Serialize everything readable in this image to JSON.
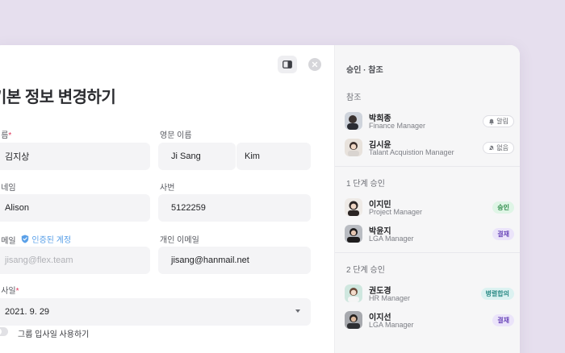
{
  "form": {
    "title": "기본 정보 변경하기",
    "name_label": "이름",
    "name_required": "*",
    "name_value": "김지상",
    "eng_name_label": "영문 이름",
    "eng_first": "Ji Sang",
    "eng_last": "Kim",
    "nickname_label": "닉네임",
    "nickname_value": "Alison",
    "employee_no_label": "사번",
    "employee_no_value": "5122259",
    "email_label": "이메일",
    "verified_label": "인증된 계정",
    "email_value": "jisang@flex.team",
    "personal_email_label": "개인 이메일",
    "personal_email_value": "jisang@hanmail.net",
    "join_date_label": "입사일",
    "join_date_required": "*",
    "join_date_value": "2021. 9. 29",
    "group_join_label": "그룹 입사일 사용하기",
    "group_join_enabled": false
  },
  "panel": {
    "title": "승인 · 참조",
    "reference_label": "참조",
    "stage1_label": "1 단계 승인",
    "stage2_label": "2 단계 승인",
    "references": [
      {
        "name": "박희종",
        "role": "Finance Manager",
        "status": "알림"
      },
      {
        "name": "김시윤",
        "role": "Talant Acquistion Manager",
        "status": "없음"
      }
    ],
    "stage1": [
      {
        "name": "이지민",
        "role": "Project Manager",
        "status": "승인"
      },
      {
        "name": "박윤지",
        "role": "LGA Manager",
        "status": "결재"
      }
    ],
    "stage2": [
      {
        "name": "권도경",
        "role": "HR Manager",
        "status": "병렬합의"
      },
      {
        "name": "이지선",
        "role": "LGA Manager",
        "status": "결재"
      }
    ]
  },
  "colors": {
    "background": "#e6dfee",
    "required": "#e0365b",
    "verified": "#5aa0e8",
    "approved": "#2e8b4a",
    "approval": "#6a47b8",
    "parallel": "#2f8d88"
  },
  "icons": [
    "panel-toggle-icon",
    "close-icon",
    "shield-check-icon",
    "bell-icon",
    "bell-off-icon",
    "chevron-down-icon"
  ]
}
